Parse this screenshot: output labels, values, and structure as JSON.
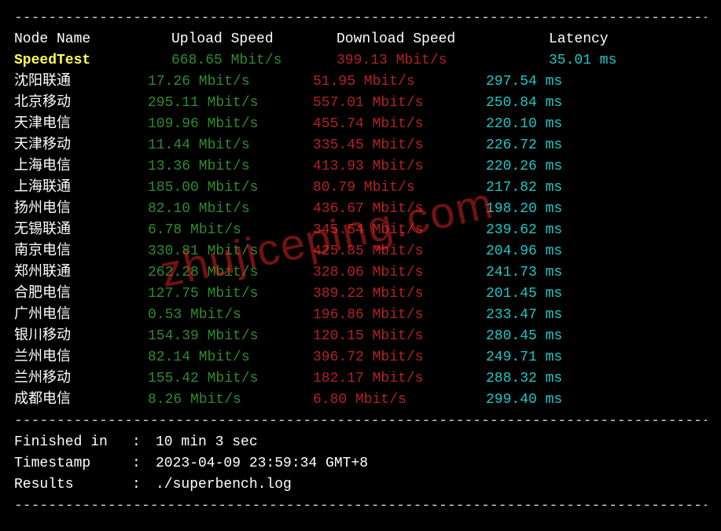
{
  "header": {
    "node": "Node Name",
    "upload": "Upload Speed",
    "download": "Download Speed",
    "latency": "Latency"
  },
  "divider": "----------------------------------------------------------------------------------",
  "speedtest": {
    "name": "SpeedTest",
    "upload": "668.65 Mbit/s",
    "download": "399.13 Mbit/s",
    "latency": "35.01 ms"
  },
  "rows": [
    {
      "node": "沈阳联通",
      "upload": "17.26 Mbit/s",
      "download": "51.95 Mbit/s",
      "latency": "297.54 ms"
    },
    {
      "node": "北京移动",
      "upload": "295.11 Mbit/s",
      "download": "557.01 Mbit/s",
      "latency": "250.84 ms"
    },
    {
      "node": "天津电信",
      "upload": "109.96 Mbit/s",
      "download": "455.74 Mbit/s",
      "latency": "220.10 ms"
    },
    {
      "node": "天津移动",
      "upload": "11.44 Mbit/s",
      "download": "335.45 Mbit/s",
      "latency": "226.72 ms"
    },
    {
      "node": "上海电信",
      "upload": "13.36 Mbit/s",
      "download": "413.93 Mbit/s",
      "latency": "220.26 ms"
    },
    {
      "node": "上海联通",
      "upload": "185.00 Mbit/s",
      "download": "80.79 Mbit/s",
      "latency": "217.82 ms"
    },
    {
      "node": "扬州电信",
      "upload": "82.10 Mbit/s",
      "download": "436.67 Mbit/s",
      "latency": "198.20 ms"
    },
    {
      "node": "无锡联通",
      "upload": "6.78 Mbit/s",
      "download": "345.54 Mbit/s",
      "latency": "239.62 ms"
    },
    {
      "node": "南京电信",
      "upload": "330.81 Mbit/s",
      "download": "425.85 Mbit/s",
      "latency": "204.96 ms"
    },
    {
      "node": "郑州联通",
      "upload": "262.28 Mbit/s",
      "download": "328.06 Mbit/s",
      "latency": "241.73 ms"
    },
    {
      "node": "合肥电信",
      "upload": "127.75 Mbit/s",
      "download": "389.22 Mbit/s",
      "latency": "201.45 ms"
    },
    {
      "node": "广州电信",
      "upload": "0.53 Mbit/s",
      "download": "196.86 Mbit/s",
      "latency": "233.47 ms"
    },
    {
      "node": "银川移动",
      "upload": "154.39 Mbit/s",
      "download": "120.15 Mbit/s",
      "latency": "280.45 ms"
    },
    {
      "node": "兰州电信",
      "upload": "82.14 Mbit/s",
      "download": "396.72 Mbit/s",
      "latency": "249.71 ms"
    },
    {
      "node": "兰州移动",
      "upload": "155.42 Mbit/s",
      "download": "182.17 Mbit/s",
      "latency": "288.32 ms"
    },
    {
      "node": "成都电信",
      "upload": "8.26 Mbit/s",
      "download": "6.80 Mbit/s",
      "latency": "299.40 ms"
    }
  ],
  "footer": {
    "finished_label": "Finished in",
    "finished_value": "10 min 3 sec",
    "timestamp_label": "Timestamp",
    "timestamp_value": "2023-04-09 23:59:34 GMT+8",
    "results_label": "Results",
    "results_value": "./superbench.log"
  },
  "watermark": "zhujiceping.com"
}
